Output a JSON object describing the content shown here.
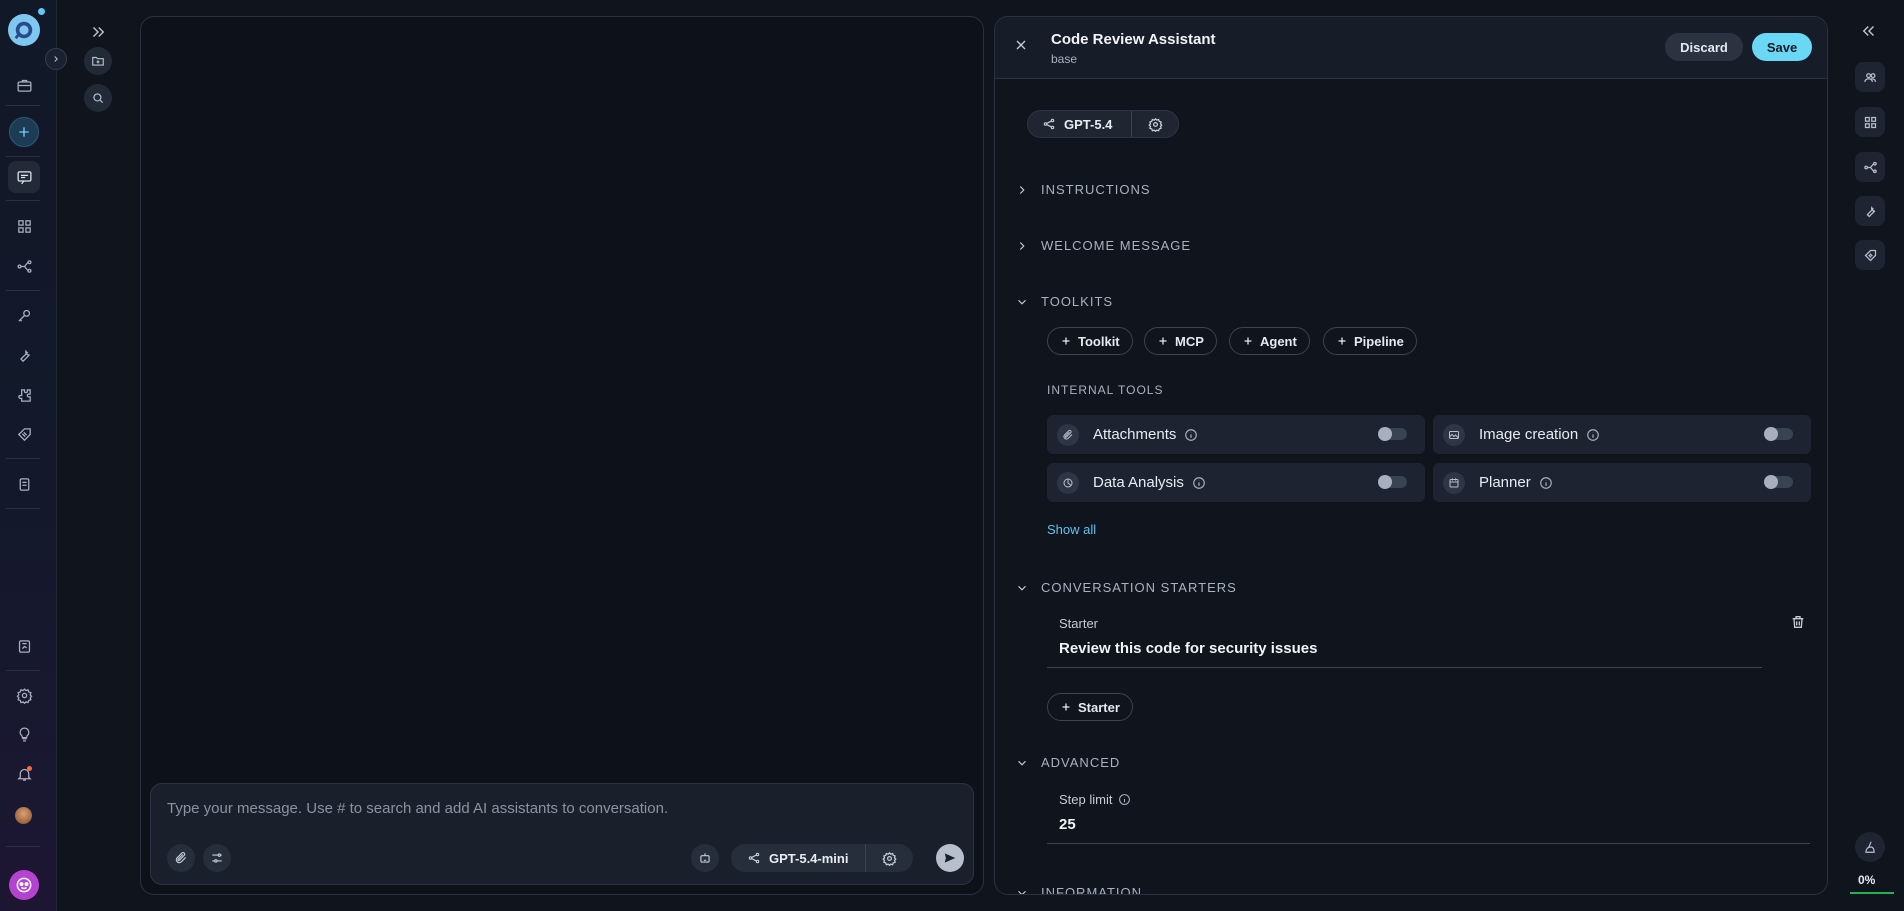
{
  "composer": {
    "placeholder": "Type your message. Use # to search and add AI assistants to conversation.",
    "model": "GPT-5.4-mini"
  },
  "editor": {
    "title": "Code Review Assistant",
    "subtitle": "base",
    "discard_label": "Discard",
    "save_label": "Save",
    "model": "GPT-5.4",
    "sections": {
      "instructions": "INSTRUCTIONS",
      "welcome": "WELCOME MESSAGE",
      "toolkits": "TOOLKITS",
      "starters": "CONVERSATION STARTERS",
      "advanced": "ADVANCED",
      "information": "INFORMATION"
    },
    "add_chips": [
      "Toolkit",
      "MCP",
      "Agent",
      "Pipeline"
    ],
    "internal_tools_label": "INTERNAL TOOLS",
    "internal_tools": [
      {
        "label": "Attachments",
        "enabled": false,
        "icon": "paperclip-icon"
      },
      {
        "label": "Image creation",
        "enabled": false,
        "icon": "image-icon"
      },
      {
        "label": "Data Analysis",
        "enabled": false,
        "icon": "analysis-icon"
      },
      {
        "label": "Planner",
        "enabled": false,
        "icon": "calendar-icon"
      }
    ],
    "show_all_label": "Show all",
    "starter": {
      "label": "Starter",
      "value": "Review this code for security issues",
      "add_label": "Starter"
    },
    "step_limit": {
      "label": "Step limit",
      "value": "25"
    }
  },
  "status": {
    "progress_label": "0%"
  }
}
